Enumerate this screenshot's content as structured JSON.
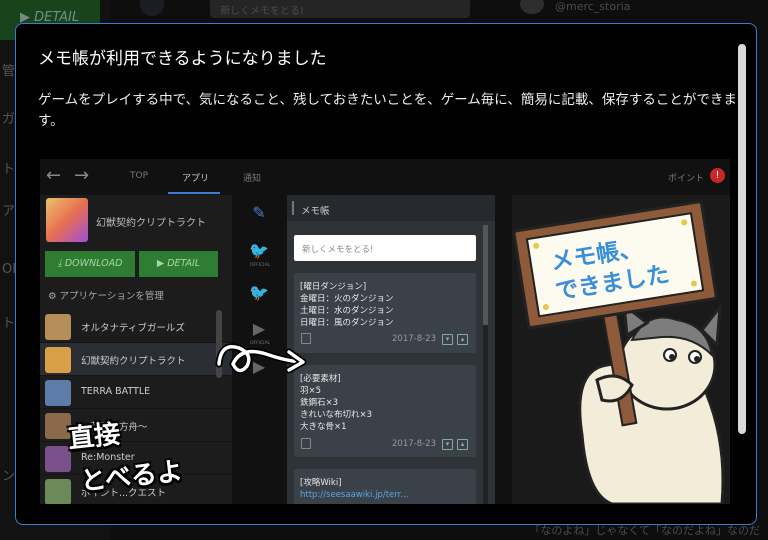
{
  "background": {
    "detail_label": "▶ DETAIL",
    "search_placeholder": "新しくメモをとる!",
    "user_handle": "@merc_storia",
    "footer_text": "「なのよね」じゃなくて「なのだよね」なのだ",
    "side_chars": [
      "管",
      "ガー",
      "ト",
      "ア",
      "OF",
      "ト",
      "ン"
    ]
  },
  "modal": {
    "title": "メモ帳が利用できるようになりました",
    "description": "ゲームをプレイする中で、気になること、残しておきたいことを、ゲーム毎に、簡易に記載、保存することができます。"
  },
  "screenshot": {
    "nav": {
      "back": "←",
      "forward": "→",
      "tabs": [
        "TOP",
        "アプリ",
        "通知"
      ],
      "points_label": "ポイント",
      "points_badge": "!"
    },
    "app": {
      "name": "幻獣契約クリプトラクト",
      "download_label": "⤓ DOWNLOAD",
      "detail_label": "▶ DETAIL",
      "manage_label": "⚙ アプリケーションを管理"
    },
    "app_list": [
      {
        "label": "オルタナティブガールズ",
        "color": "#b58e5a"
      },
      {
        "label": "幻獣契約クリプトラクト",
        "color": "#d9a04a"
      },
      {
        "label": "TERRA BATTLE",
        "color": "#5b7da8"
      },
      {
        "label": "～荒野の方舟～",
        "color": "#8a6a4a"
      },
      {
        "label": "Re:Monster",
        "color": "#7a4f8a"
      },
      {
        "label": "ポイント...クエスト",
        "color": "#6a8a5a"
      }
    ],
    "icons": [
      {
        "name": "memo-edit-icon",
        "glyph": "✎",
        "caption": ""
      },
      {
        "name": "twitter-official-icon",
        "glyph": "🐦",
        "caption": "OFFICIAL"
      },
      {
        "name": "twitter-icon",
        "glyph": "🐦",
        "caption": ""
      },
      {
        "name": "youtube-official-icon",
        "glyph": "▶",
        "caption": "OFFICIAL"
      },
      {
        "name": "youtube-icon",
        "glyph": "▶",
        "caption": ""
      }
    ],
    "memo": {
      "header": "メモ帳",
      "input_placeholder": "新しくメモをとる!",
      "cards": [
        {
          "text": "[曜日ダンジョン]\n金曜日：火のダンジョン\n土曜日：水のダンジョン\n日曜日：風のダンジョン",
          "date": "2017-8-23"
        },
        {
          "text": "[必要素材]\n羽×5\n鉄鋼石×3\nきれいな布切れ×3\n大きな骨×1",
          "date": "2017-8-23"
        },
        {
          "title": "[攻略Wiki]",
          "link": "http://seesaawiki.jp/terr..."
        }
      ]
    },
    "sign": {
      "line1": "メモ帳、",
      "line2": "できました"
    },
    "handwritten": {
      "line1": "直接",
      "line2": "とべるよ"
    }
  }
}
